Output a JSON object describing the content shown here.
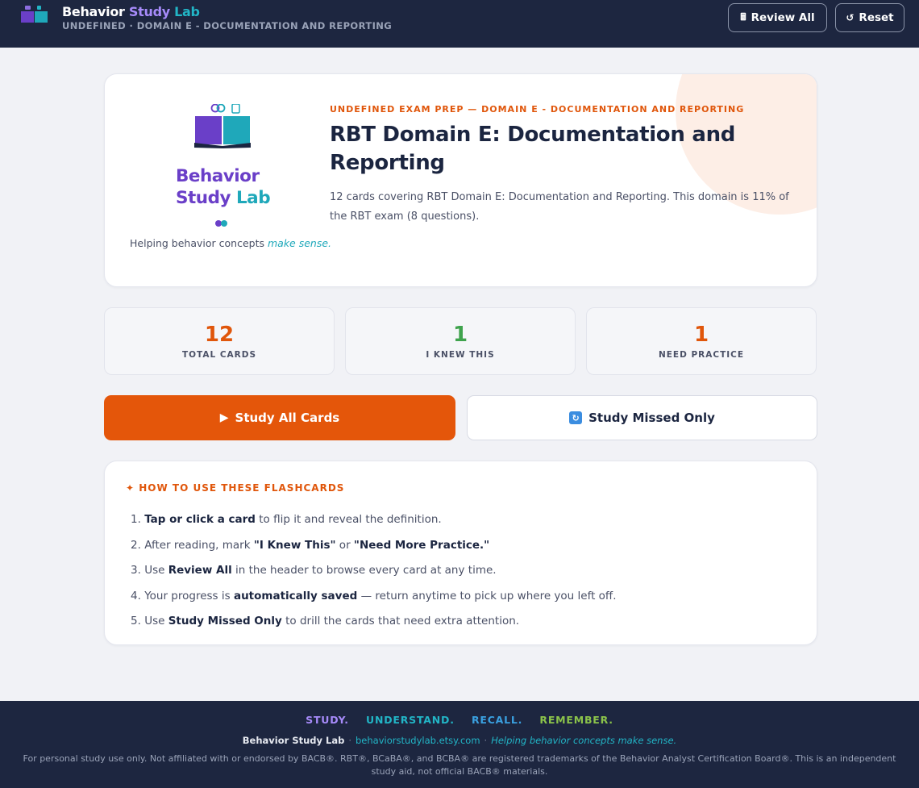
{
  "header": {
    "brand": {
      "word1": "Behavior",
      "word2": "Study",
      "word3": "Lab"
    },
    "subtitle": "UNDEFINED · DOMAIN E - DOCUMENTATION AND REPORTING",
    "review_all_label": "Review All",
    "review_all_icon": "calculator-icon",
    "reset_label": "Reset",
    "reset_icon": "reload-icon"
  },
  "hero": {
    "logo": {
      "line1": "Behavior",
      "line2_a": "Study",
      "line2_b": "Lab",
      "tagline": "Helping behavior concepts",
      "tagline_em": "make sense."
    },
    "eyebrow": "UNDEFINED EXAM PREP — DOMAIN E - DOCUMENTATION AND REPORTING",
    "title": "RBT Domain E: Documentation and Reporting",
    "description": "12 cards covering RBT Domain E: Documentation and Reporting. This domain is 11% of the RBT exam (8 questions)."
  },
  "stats": [
    {
      "value": "12",
      "label": "TOTAL CARDS",
      "color": "#e0560b"
    },
    {
      "value": "1",
      "label": "I KNEW THIS",
      "color": "#3fa34d"
    },
    {
      "value": "1",
      "label": "NEED PRACTICE",
      "color": "#e0560b"
    }
  ],
  "actions": {
    "study_all": "Study All Cards",
    "study_missed": "Study Missed Only"
  },
  "howto": {
    "title": "HOW TO USE THESE FLASHCARDS",
    "items": [
      {
        "n": "1.",
        "a": "Tap or click a card",
        "b": " to flip it and reveal the definition."
      },
      {
        "n": "2.",
        "a": "After reading, mark ",
        "b": "\"I Knew This\"",
        "c": " or ",
        "d": "\"Need More Practice.\""
      },
      {
        "n": "3.",
        "a": "Use ",
        "b": "Review All",
        "c": " in the header to browse every card at any time."
      },
      {
        "n": "4.",
        "a": "Your progress is ",
        "b": "automatically saved",
        "c": " — return anytime to pick up where you left off."
      },
      {
        "n": "5.",
        "a": "Use ",
        "b": "Study Missed Only",
        "c": " to drill the cards that need extra attention."
      }
    ]
  },
  "footer": {
    "motto": [
      {
        "text": "STUDY.",
        "color": "#a78bfa"
      },
      {
        "text": "UNDERSTAND.",
        "color": "#22b5c6"
      },
      {
        "text": "RECALL.",
        "color": "#3aa0e0"
      },
      {
        "text": "REMEMBER.",
        "color": "#8bc34a"
      }
    ],
    "name": "Behavior Study Lab",
    "url": "behaviorstudylab.etsy.com",
    "tagline": "Helping behavior concepts make sense.",
    "disclaimer": "For personal study use only. Not affiliated with or endorsed by BACB®. RBT®, BCaBA®, and BCBA® are registered trademarks of the Behavior Analyst Certification Board®. This is an independent study aid, not official BACB® materials."
  },
  "colors": {
    "accent": "#e4560a",
    "navy": "#1d2640",
    "purple": "#6a3fc8",
    "teal": "#1fa8ba"
  }
}
